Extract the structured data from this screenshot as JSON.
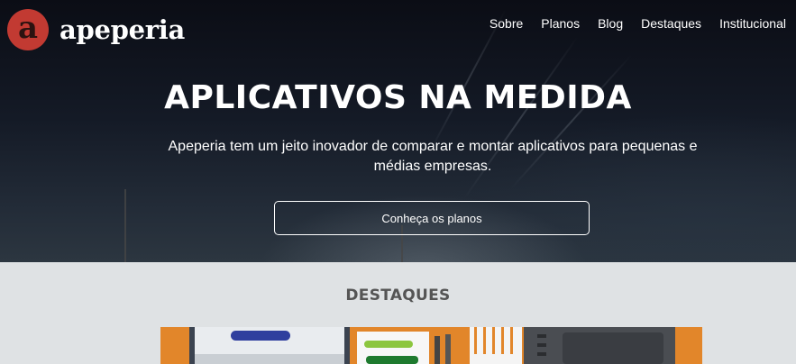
{
  "brand": {
    "logo_letter": "a",
    "name": "apeperia",
    "accent_color": "#c23a32"
  },
  "nav": {
    "items": [
      "Sobre",
      "Planos",
      "Blog",
      "Destaques",
      "Institucional"
    ]
  },
  "hero": {
    "title": "APLICATIVOS NA MEDIDA",
    "subtitle": "Apeperia tem um jeito inovador de comparar e montar aplicativos para pequenas e médias empresas.",
    "cta_label": "Conheça os planos"
  },
  "highlights": {
    "title": "DESTAQUES"
  }
}
